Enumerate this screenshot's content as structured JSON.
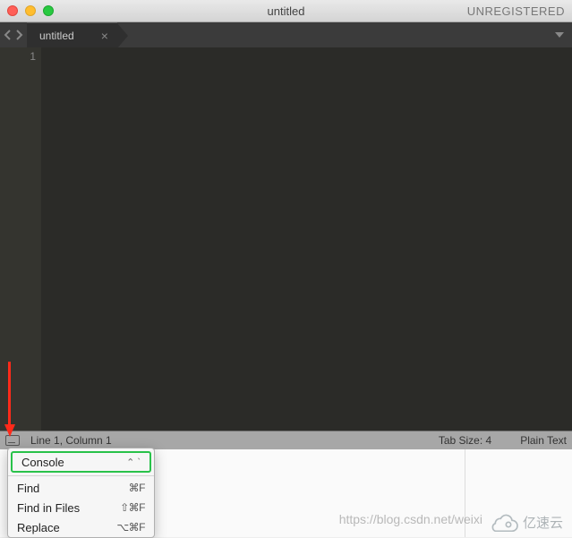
{
  "titlebar": {
    "title": "untitled",
    "unregistered": "UNREGISTERED"
  },
  "tabs": {
    "active": {
      "label": "untitled"
    }
  },
  "gutter": {
    "line1": "1"
  },
  "statusbar": {
    "position": "Line 1, Column 1",
    "tabsize": "Tab Size: 4",
    "syntax": "Plain Text"
  },
  "popup": {
    "console": "Console",
    "console_shortcut": "⌃ `",
    "find": {
      "label": "Find",
      "shortcut": "⌘F"
    },
    "find_in_files": {
      "label": "Find in Files",
      "shortcut": "⇧⌘F"
    },
    "replace": {
      "label": "Replace",
      "shortcut": "⌥⌘F"
    }
  },
  "watermark": {
    "url": "https://blog.csdn.net/weixi",
    "brand": "亿速云"
  }
}
